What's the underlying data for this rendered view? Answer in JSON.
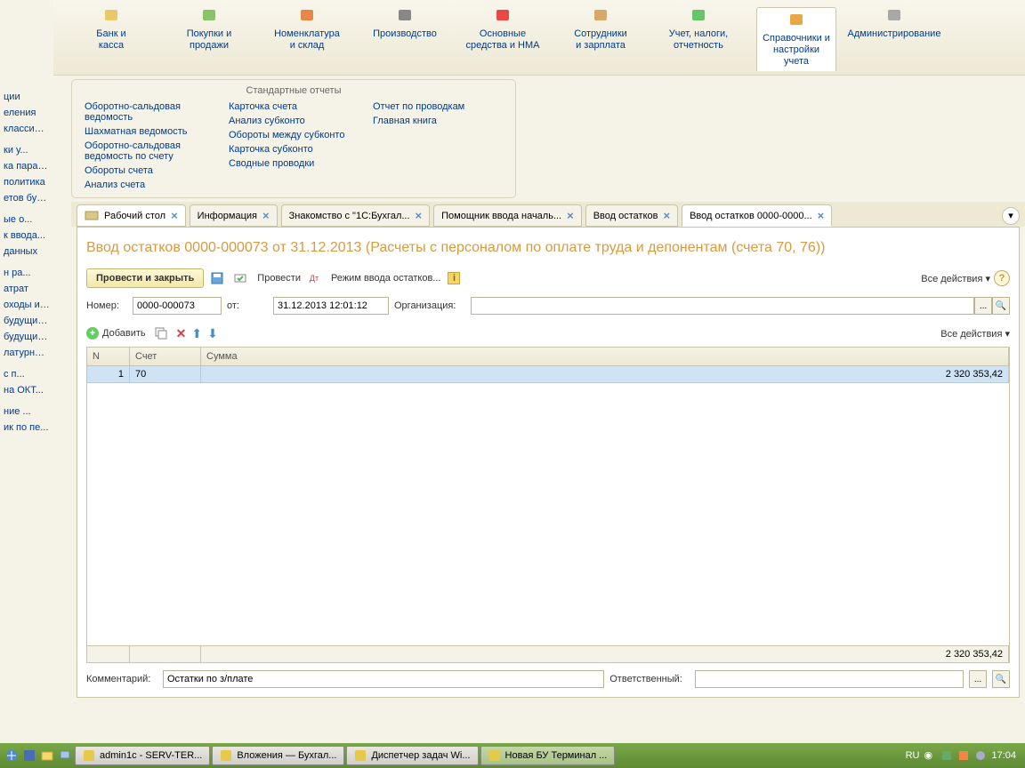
{
  "nav": [
    {
      "label": "Банк и\nкасса"
    },
    {
      "label": "Покупки и\nпродажи"
    },
    {
      "label": "Номенклатура\nи склад"
    },
    {
      "label": "Производство"
    },
    {
      "label": "Основные\nсредства и НМА"
    },
    {
      "label": "Сотрудники\nи зарплата"
    },
    {
      "label": "Учет, налоги,\nотчетность"
    },
    {
      "label": "Справочники и\nнастройки учета"
    },
    {
      "label": "Администрирование"
    }
  ],
  "reports": {
    "title": "Стандартные отчеты",
    "col1": [
      "Оборотно-сальдовая ведомость",
      "Шахматная ведомость",
      "Оборотно-сальдовая ведомость по счету",
      "Обороты счета",
      "Анализ счета"
    ],
    "col2": [
      "Карточка счета",
      "Анализ субконто",
      "Обороты между субконто",
      "Карточка субконто",
      "Сводные проводки"
    ],
    "col3": [
      "Отчет по проводкам",
      "Главная книга"
    ]
  },
  "sidebar": [
    "ции",
    "еления",
    "классиф...",
    "",
    "ки у...",
    "ка парам...",
    "политика",
    "етов бухг...",
    "",
    "ые о...",
    "к ввода...",
    "данных",
    "",
    "н ра...",
    "атрат",
    "оходы и ...",
    "будущих ...",
    "будущих...",
    "латурные...",
    "",
    "с п...",
    "на ОКТ...",
    "",
    "ние ...",
    "ик по пе..."
  ],
  "tabs": [
    {
      "label": "Рабочий стол",
      "desk": true
    },
    {
      "label": "Информация"
    },
    {
      "label": "Знакомство с \"1С:Бухгал..."
    },
    {
      "label": "Помощник ввода началь..."
    },
    {
      "label": "Ввод остатков"
    },
    {
      "label": "Ввод остатков 0000-0000...",
      "active": true
    }
  ],
  "doc": {
    "title": "Ввод остатков 0000-000073 от 31.12.2013 (Расчеты с персоналом по оплате труда и депонентам (счета 70, 76))",
    "btn_main": "Провести и закрыть",
    "btn_post": "Провести",
    "btn_mode": "Режим ввода остатков...",
    "all_actions": "Все действия",
    "num_label": "Номер:",
    "num_value": "0000-000073",
    "date_label": "от:",
    "date_value": "31.12.2013 12:01:12",
    "org_label": "Организация:",
    "org_value": "",
    "add_label": "Добавить",
    "cols": {
      "n": "N",
      "acc": "Счет",
      "sum": "Сумма"
    },
    "rows": [
      {
        "n": "1",
        "acc": "70",
        "sum": "2 320 353,42"
      }
    ],
    "total": "2 320 353,42",
    "comment_label": "Комментарий:",
    "comment_value": "Остатки по з/плате",
    "resp_label": "Ответственный:",
    "resp_value": ""
  },
  "taskbar": {
    "items": [
      {
        "label": "admin1c - SERV-TER..."
      },
      {
        "label": "Вложения — Бухгал..."
      },
      {
        "label": "Диспетчер задач Wi..."
      },
      {
        "label": "Новая БУ Терминал ...",
        "active": true
      }
    ],
    "lang": "RU",
    "time": "17:04"
  }
}
